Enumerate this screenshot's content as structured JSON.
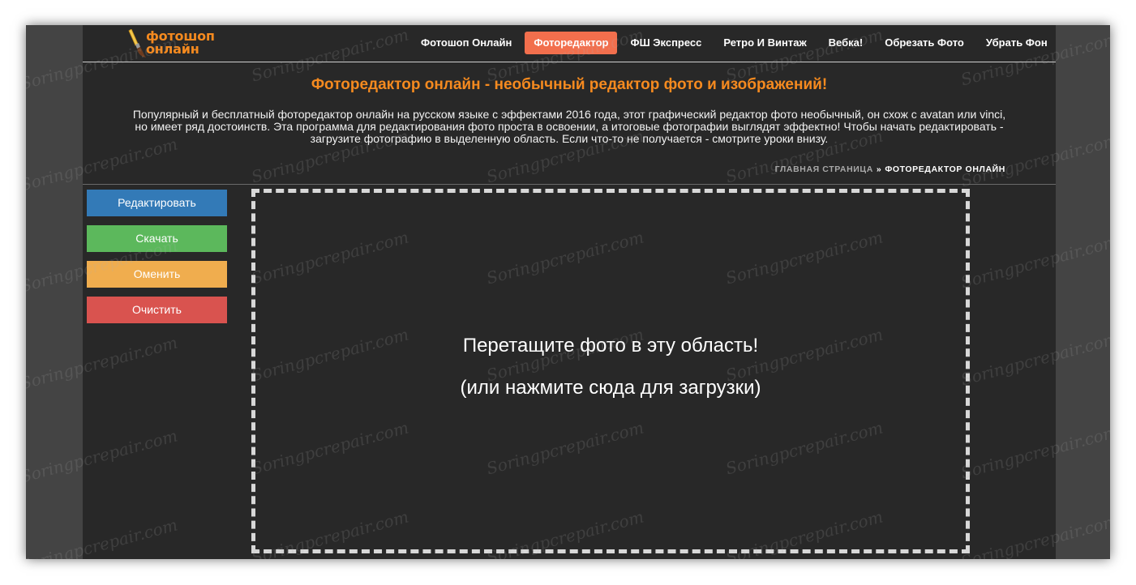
{
  "logo": {
    "line1": "фотошоп",
    "line2": "онлайн"
  },
  "nav": [
    {
      "label": "Фотошоп Онлайн",
      "active": false
    },
    {
      "label": "Фоторедактор",
      "active": true
    },
    {
      "label": "ФШ Экспресс",
      "active": false
    },
    {
      "label": "Ретро И Винтаж",
      "active": false
    },
    {
      "label": "Вебка!",
      "active": false
    },
    {
      "label": "Обрезать Фото",
      "active": false
    },
    {
      "label": "Убрать Фон",
      "active": false
    }
  ],
  "page": {
    "title": "Фоторедактор онлайн - необычный редактор фото и изображений!",
    "intro": "Популярный и бесплатный фоторедактор онлайн на русском языке с эффектами 2016 года, этот графический редактор фото необычный, он схож с avatan или vinci, но имеет ряд достоинств. Эта программа для редактирования фото проста в освоении, а итоговые фотографии выглядят эффектно! Чтобы начать редактировать - загрузите фотографию в выделенную область. Если что-то не получается - смотрите уроки внизу."
  },
  "breadcrumb": {
    "home": "ГЛАВНАЯ СТРАНИЦА",
    "separator": "»",
    "current": "ФОТОРЕДАКТОР ОНЛАЙН"
  },
  "sidebar": {
    "edit": "Редактировать",
    "download": "Скачать",
    "undo": "Оменить",
    "clear": "Очистить"
  },
  "dropzone": {
    "line1": "Перетащите фото в эту область!",
    "line2": "(или нажмите сюда для загрузки)"
  },
  "watermark": "Soringpcrepair.com",
  "colors": {
    "accent": "#f58a1f",
    "active_nav": "#f26f4d",
    "edit": "#337ab7",
    "download": "#5cb85c",
    "undo": "#f0ad4e",
    "clear": "#d9534f",
    "page_bg": "#282828",
    "frame_bg": "#444444"
  }
}
